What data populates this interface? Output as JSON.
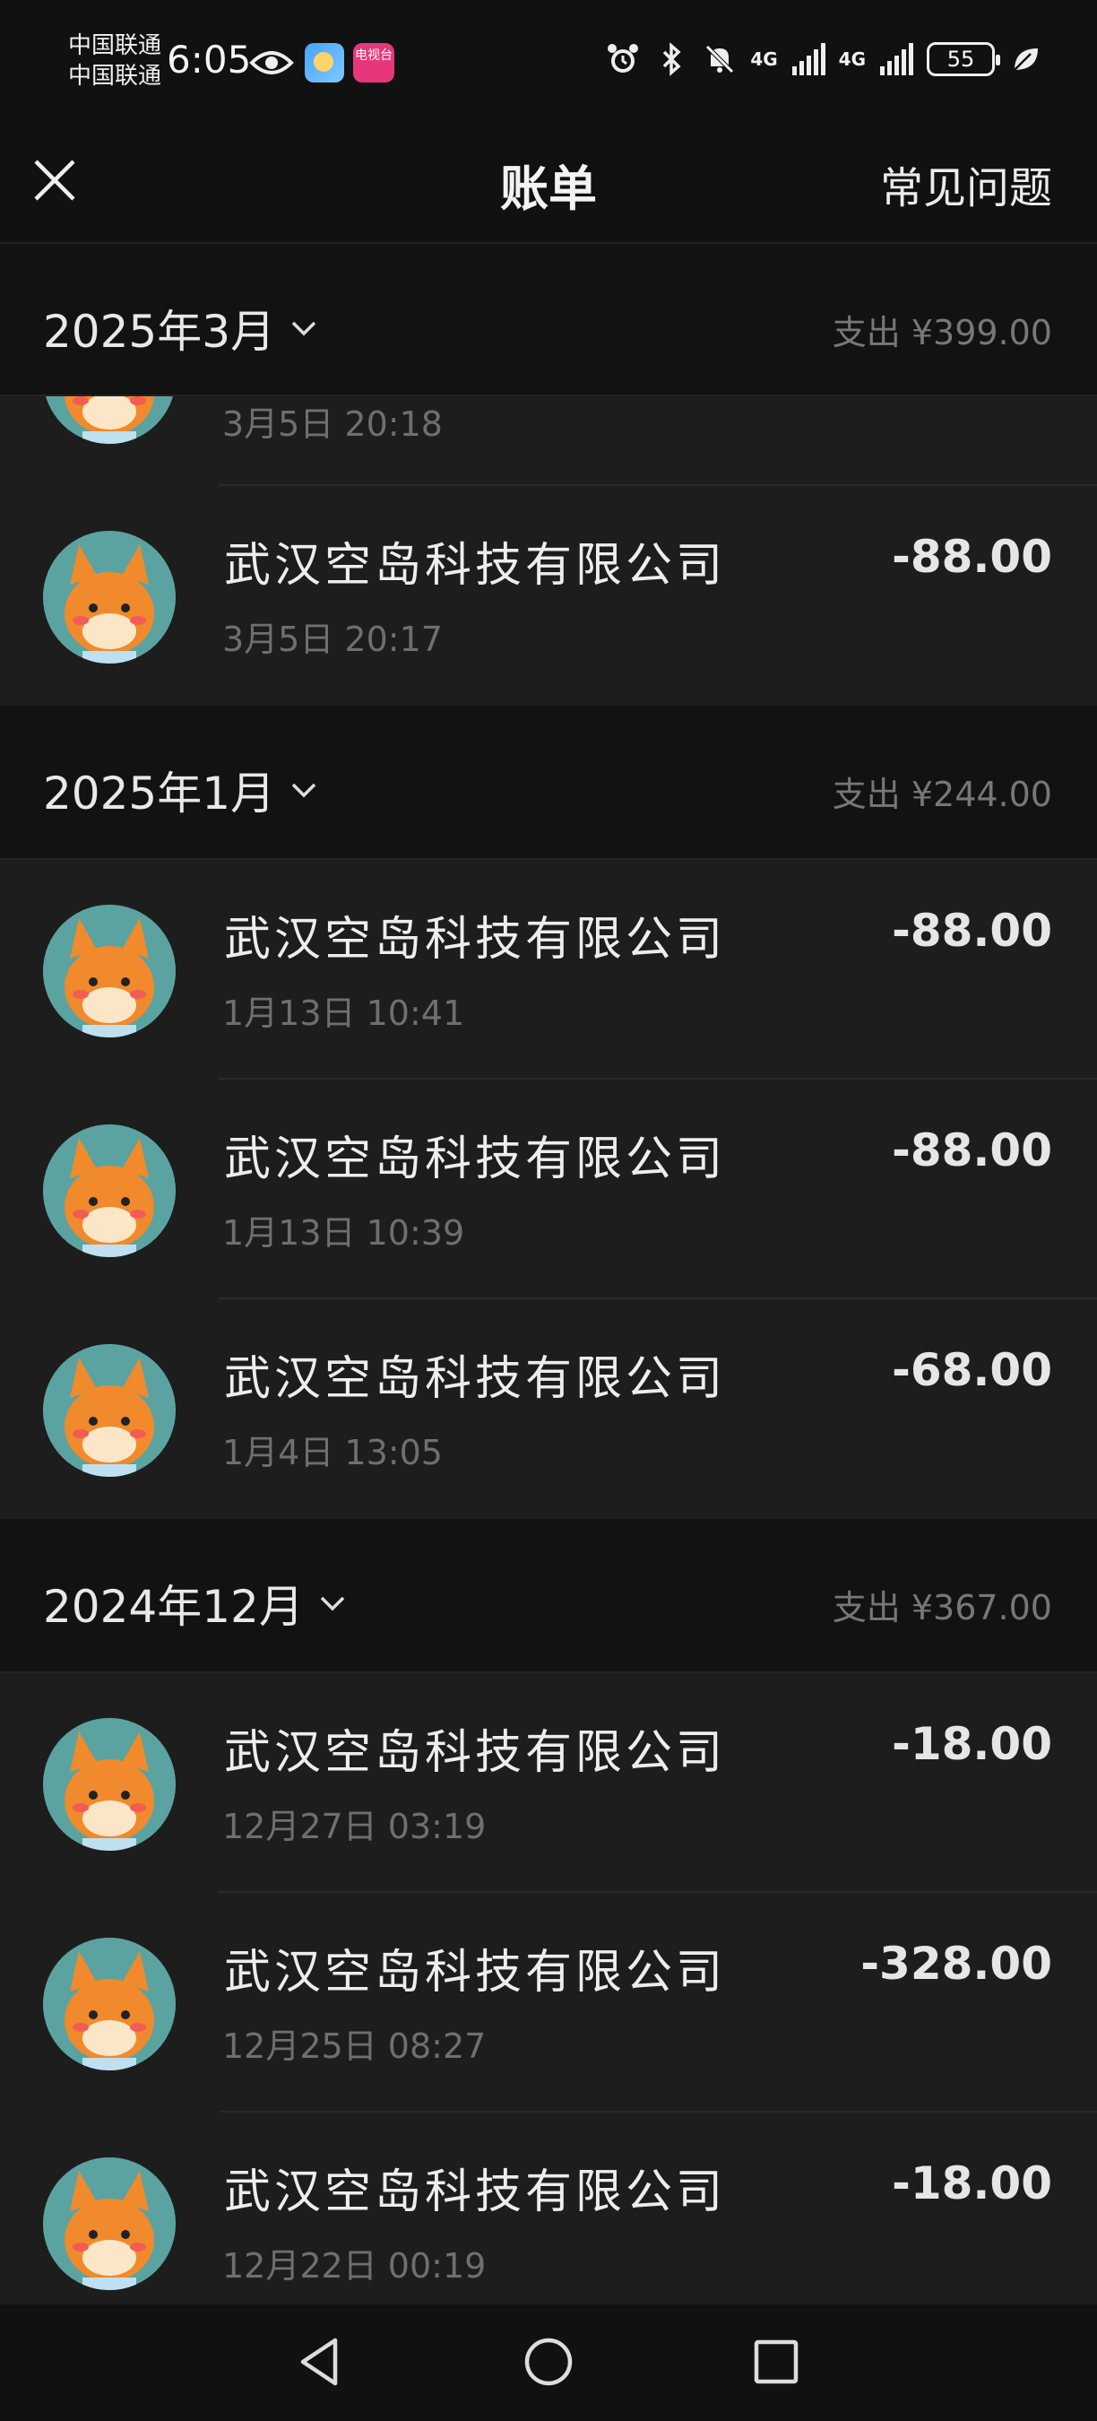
{
  "status_bar": {
    "carrier1": "中国联通",
    "carrier2": "中国联通",
    "time": "6:05",
    "app2_label": "电视台",
    "network1": "4G",
    "network2": "4G",
    "battery": "55"
  },
  "nav": {
    "title": "账单",
    "faq": "常见问题"
  },
  "sections": [
    {
      "month": "2025年3月",
      "total": "支出 ¥399.00",
      "rows": [
        {
          "merchant": "",
          "time": "3月5日 20:18",
          "amount": ""
        },
        {
          "merchant": "武汉空岛科技有限公司",
          "time": "3月5日 20:17",
          "amount": "-88.00"
        }
      ]
    },
    {
      "month": "2025年1月",
      "total": "支出 ¥244.00",
      "rows": [
        {
          "merchant": "武汉空岛科技有限公司",
          "time": "1月13日 10:41",
          "amount": "-88.00"
        },
        {
          "merchant": "武汉空岛科技有限公司",
          "time": "1月13日 10:39",
          "amount": "-88.00"
        },
        {
          "merchant": "武汉空岛科技有限公司",
          "time": "1月4日 13:05",
          "amount": "-68.00"
        }
      ]
    },
    {
      "month": "2024年12月",
      "total": "支出 ¥367.00",
      "rows": [
        {
          "merchant": "武汉空岛科技有限公司",
          "time": "12月27日 03:19",
          "amount": "-18.00"
        },
        {
          "merchant": "武汉空岛科技有限公司",
          "time": "12月25日 08:27",
          "amount": "-328.00"
        },
        {
          "merchant": "武汉空岛科技有限公司",
          "time": "12月22日 00:19",
          "amount": "-18.00"
        }
      ]
    }
  ],
  "colors": {
    "background": "#1b1b1b",
    "header_bg": "#121212",
    "avatar_bg": "#5ba3a0",
    "avatar_face": "#f08a2c"
  }
}
